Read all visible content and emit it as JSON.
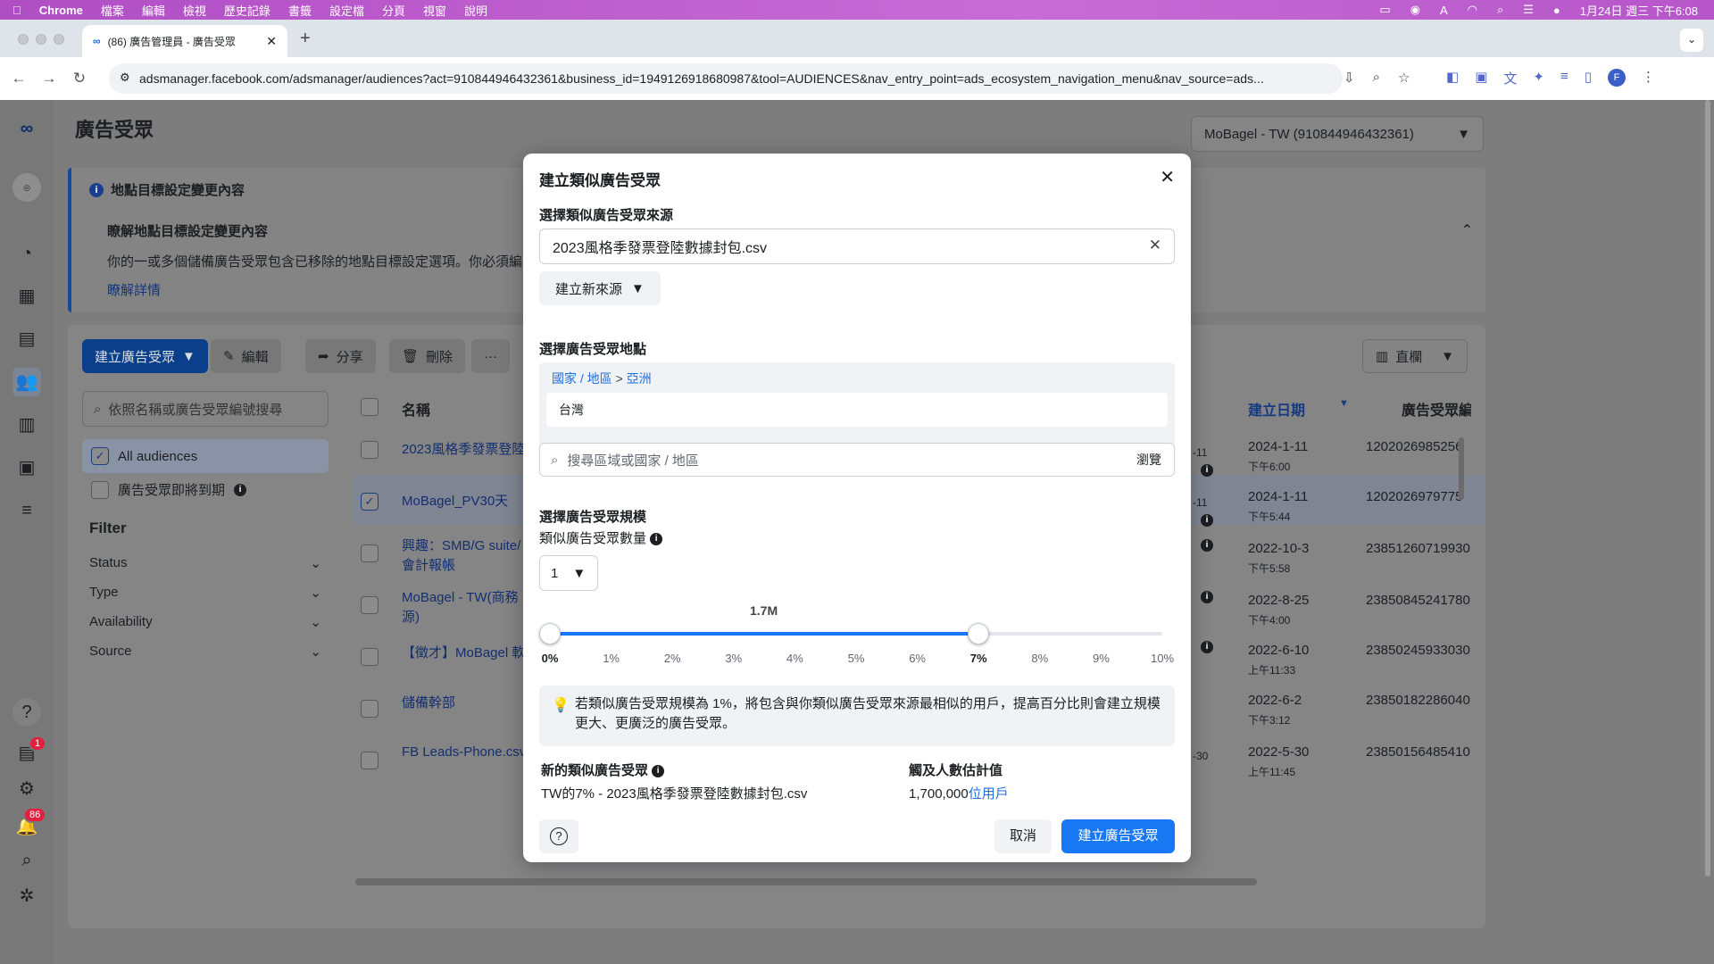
{
  "menubar": {
    "apple": "",
    "app": "Chrome",
    "items": [
      "檔案",
      "編輯",
      "檢視",
      "歷史記錄",
      "書籤",
      "設定檔",
      "分頁",
      "視窗",
      "說明"
    ],
    "clock": "1月24日 週三 下午6:08"
  },
  "browser": {
    "tab_title": "(86) 廣告管理員 - 廣告受眾",
    "url": "adsmanager.facebook.com/adsmanager/audiences?act=910844946432361&business_id=1949126918680987&tool=AUDIENCES&nav_entry_point=ads_ecosystem_navigation_menu&nav_source=ads...",
    "profile": "F"
  },
  "page": {
    "title": "廣告受眾",
    "account": "MoBagel - TW (910844946432361)"
  },
  "nav": {
    "help_badge": "1",
    "notif_badge": "86"
  },
  "notice": {
    "title": "地點目標設定變更內容",
    "heading": "瞭解地點目標設定變更內容",
    "body": "你的一或多個儲備廣告受眾包含已移除的地點目標設定選項。你必須編",
    "link": "瞭解詳情"
  },
  "toolbar": {
    "create": "建立廣告受眾",
    "edit": "編輯",
    "share": "分享",
    "delete": "刪除",
    "more": "···",
    "columns": "直欄"
  },
  "sidebar": {
    "search_placeholder": "依照名稱或廣告受眾編號搜尋",
    "all": "All audiences",
    "expiring": "廣告受眾即將到期",
    "filter": "Filter",
    "filters": [
      "Status",
      "Type",
      "Availability",
      "Source"
    ]
  },
  "table": {
    "col_name": "名稱",
    "col_date": "建立日期",
    "col_id": "廣告受眾編",
    "rows": [
      {
        "name": "2023風格季發票登陸",
        "date": "2024-1-11",
        "time": "下午6:00",
        "id": "1202026985256",
        "checked": false
      },
      {
        "name": "MoBagel_PV30天",
        "date": "2024-1-11",
        "time": "下午5:44",
        "id": "1202026979775",
        "checked": true
      },
      {
        "name": "興趣：SMB/G suite/",
        "name2": "會計報帳",
        "date": "2022-10-3",
        "time": "下午5:58",
        "id": "23851260719930",
        "checked": false
      },
      {
        "name": "MoBagel - TW(商務",
        "name2": "源)",
        "date": "2022-8-25",
        "time": "下午4:00",
        "id": "23850845241780",
        "checked": false
      },
      {
        "name": "【徵才】MoBagel 軟",
        "date": "2022-6-10",
        "time": "上午11:33",
        "id": "23850245933030",
        "checked": false
      },
      {
        "name": "儲備幹部",
        "date": "2022-6-2",
        "time": "下午3:12",
        "id": "23850182286040",
        "checked": false
      },
      {
        "name": "FB Leads-Phone.csv",
        "date": "2022-5-30",
        "time": "上午11:45",
        "id": "23850156485410",
        "checked": false
      }
    ],
    "partial": [
      "-11",
      "-11",
      "-30"
    ]
  },
  "modal": {
    "title": "建立類似廣告受眾",
    "source_label": "選擇類似廣告受眾來源",
    "source_value": "2023風格季發票登陸數據封包.csv",
    "new_source": "建立新來源",
    "location_label": "選擇廣告受眾地點",
    "crumb": [
      "國家 / 地區",
      ">",
      "亞洲"
    ],
    "location_value": "台灣",
    "location_search_placeholder": "搜尋區域或國家 / 地區",
    "browse": "瀏覽",
    "size_label": "選擇廣告受眾規模",
    "count_label": "類似廣告受眾數量",
    "count_value": "1",
    "slider_value_label": "1.7M",
    "slider_start_pct": 0,
    "slider_end_pct": 7,
    "ticks": [
      "0%",
      "1%",
      "2%",
      "3%",
      "4%",
      "5%",
      "6%",
      "7%",
      "8%",
      "9%",
      "10%"
    ],
    "tip": "若類似廣告受眾規模為 1%，將包含與你類似廣告受眾來源最相似的用戶，提高百分比則會建立規模更大、更廣泛的廣告受眾。",
    "new_audience_label": "新的類似廣告受眾",
    "new_audience_value": "TW的7% - 2023風格季發票登陸數據封包.csv",
    "reach_label": "觸及人數估計值",
    "reach_value": "1,700,000",
    "reach_unit": "位用戶",
    "help": "?",
    "cancel": "取消",
    "create": "建立廣告受眾"
  },
  "colors": {
    "primary": "#1877f2",
    "link": "#216fdb"
  }
}
